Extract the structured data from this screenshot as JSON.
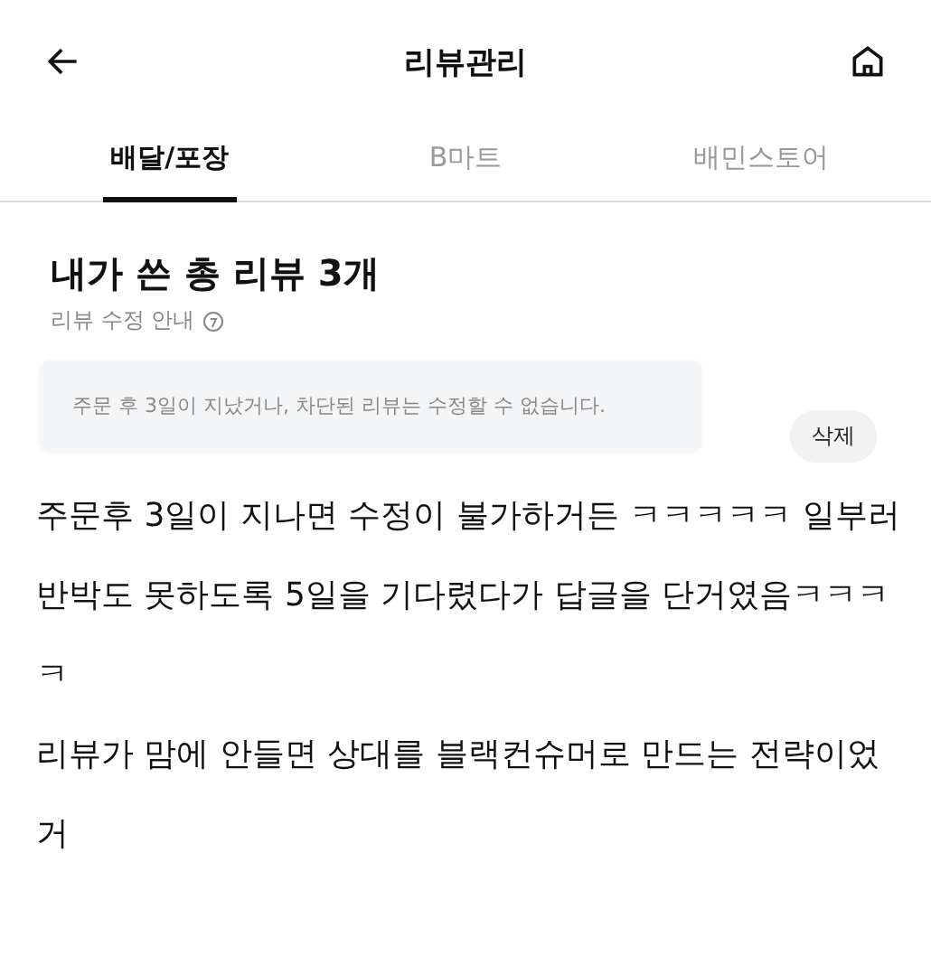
{
  "header": {
    "title": "리뷰관리"
  },
  "tabs": [
    {
      "label": "배달/포장",
      "selected": true
    },
    {
      "label": "B마트",
      "selected": false
    },
    {
      "label": "배민스토어",
      "selected": false
    }
  ],
  "summary": {
    "title": "내가 쓴 총 리뷰 3개",
    "guide": "리뷰 수정 안내"
  },
  "tooltip": "주문 후 3일이 지났거나, 차단된 리뷰는 수정할 수 없습니다.",
  "delete_button": "삭제",
  "comments": [
    "주문후 3일이 지나면 수정이 불가하거든 ㅋㅋㅋㅋㅋ 일부러 반박도 못하도록 5일을 기다렸다가 답글을 단거였음ㅋㅋㅋㅋ",
    "리뷰가 맘에 안들면 상대를 블랙컨슈머로 만드는 전략이었거"
  ]
}
